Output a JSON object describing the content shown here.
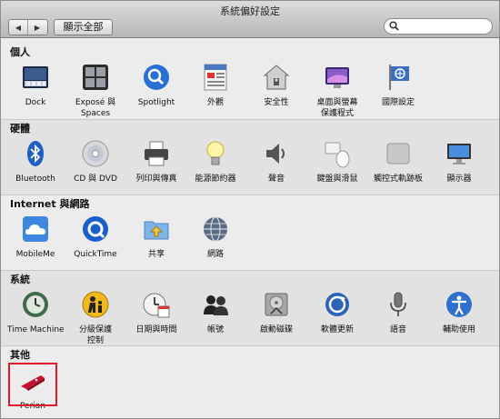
{
  "window": {
    "title": "系統偏好設定"
  },
  "toolbar": {
    "back_icon": "back-arrow-icon",
    "forward_icon": "forward-arrow-icon",
    "show_all_label": "顯示全部",
    "search_value": "",
    "search_placeholder": ""
  },
  "sections": [
    {
      "title": "個人",
      "items": [
        {
          "label": "Dock",
          "icon": "dock-icon"
        },
        {
          "label": "Exposé 與\nSpaces",
          "icon": "expose-spaces-icon"
        },
        {
          "label": "Spotlight",
          "icon": "spotlight-icon"
        },
        {
          "label": "外觀",
          "icon": "appearance-icon"
        },
        {
          "label": "安全性",
          "icon": "security-icon"
        },
        {
          "label": "桌面與螢幕\n保護程式",
          "icon": "desktop-screensaver-icon"
        },
        {
          "label": "國際設定",
          "icon": "international-icon"
        }
      ]
    },
    {
      "title": "硬體",
      "items": [
        {
          "label": "Bluetooth",
          "icon": "bluetooth-icon"
        },
        {
          "label": "CD 與 DVD",
          "icon": "cd-dvd-icon"
        },
        {
          "label": "列印與傳真",
          "icon": "print-fax-icon"
        },
        {
          "label": "能源節約器",
          "icon": "energy-saver-icon"
        },
        {
          "label": "聲音",
          "icon": "sound-icon"
        },
        {
          "label": "鍵盤與滑鼠",
          "icon": "keyboard-mouse-icon"
        },
        {
          "label": "觸控式軌跡板",
          "icon": "trackpad-icon"
        },
        {
          "label": "顯示器",
          "icon": "displays-icon"
        }
      ]
    },
    {
      "title": "Internet 與網路",
      "items": [
        {
          "label": "MobileMe",
          "icon": "mobileme-icon"
        },
        {
          "label": "QuickTime",
          "icon": "quicktime-icon"
        },
        {
          "label": "共享",
          "icon": "sharing-icon"
        },
        {
          "label": "網路",
          "icon": "network-icon"
        }
      ]
    },
    {
      "title": "系統",
      "items": [
        {
          "label": "Time Machine",
          "icon": "time-machine-icon"
        },
        {
          "label": "分級保護\n控制",
          "icon": "parental-controls-icon"
        },
        {
          "label": "日期與時間",
          "icon": "date-time-icon"
        },
        {
          "label": "帳號",
          "icon": "accounts-icon"
        },
        {
          "label": "啟動磁碟",
          "icon": "startup-disk-icon"
        },
        {
          "label": "軟體更新",
          "icon": "software-update-icon"
        },
        {
          "label": "語音",
          "icon": "speech-icon"
        },
        {
          "label": "輔助使用",
          "icon": "universal-access-icon"
        }
      ]
    },
    {
      "title": "其他",
      "items": [
        {
          "label": "Perian",
          "icon": "perian-icon"
        }
      ]
    }
  ],
  "colors": {
    "highlight": "#e0182a"
  }
}
